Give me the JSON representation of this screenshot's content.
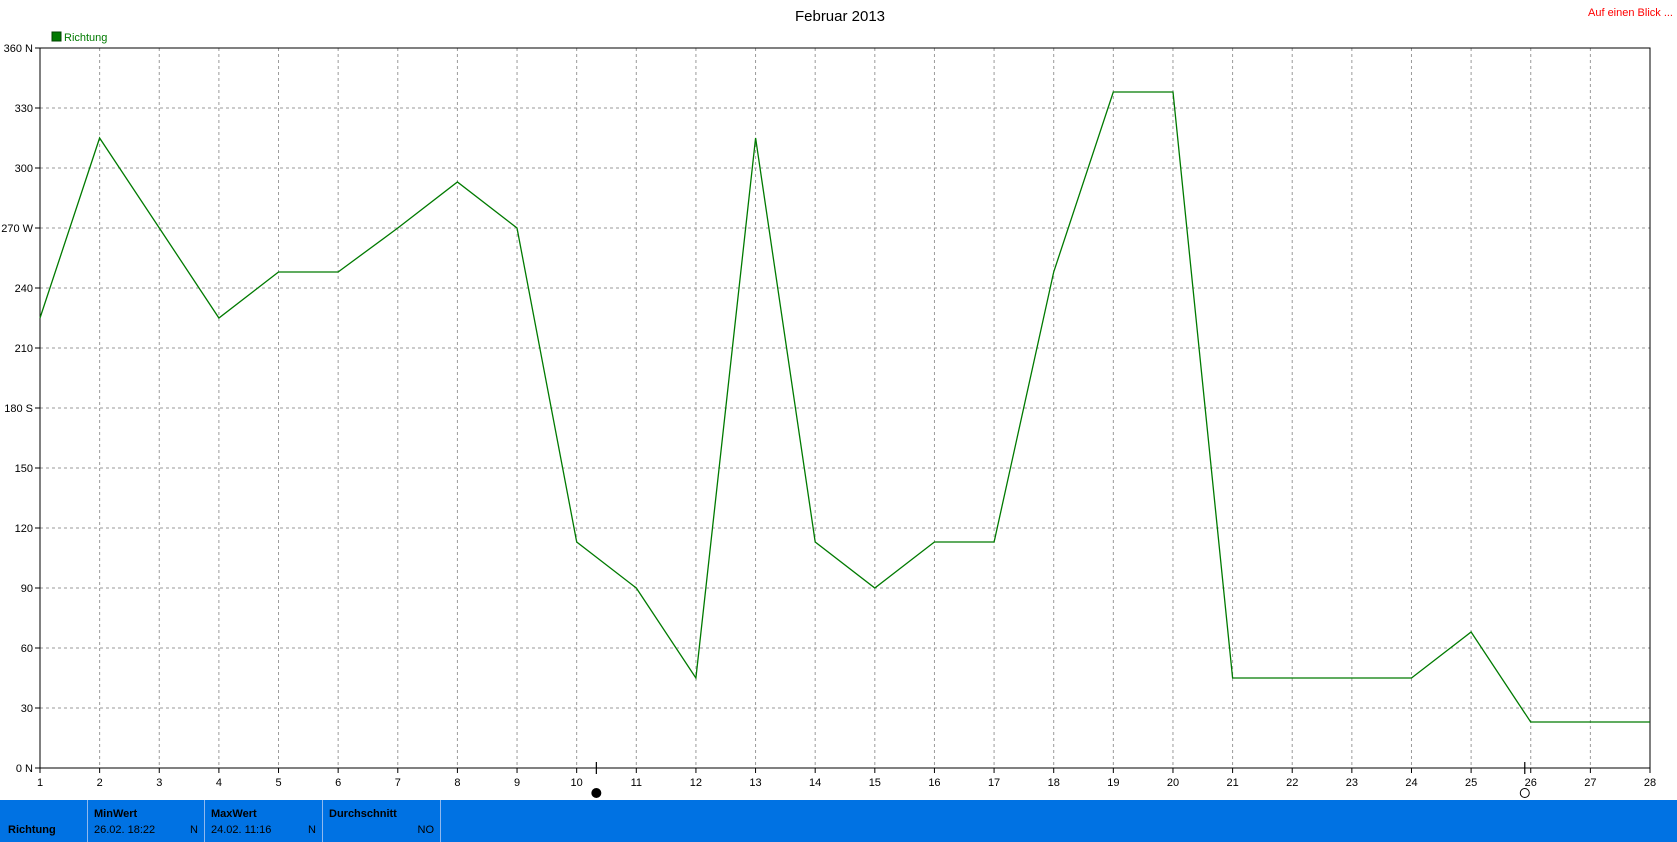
{
  "title": "Februar 2013",
  "link": "Auf einen Blick ...",
  "legend": {
    "label": "Richtung",
    "color": "#007a00"
  },
  "chart_data": {
    "type": "line",
    "title": "Februar 2013",
    "x": [
      1,
      2,
      3,
      4,
      5,
      6,
      7,
      8,
      9,
      10,
      11,
      12,
      13,
      14,
      15,
      16,
      17,
      18,
      19,
      20,
      21,
      22,
      23,
      24,
      25,
      26,
      27,
      28
    ],
    "xlim": [
      1,
      28
    ],
    "ylim": [
      0,
      360
    ],
    "y_ticks": [
      {
        "value": 360,
        "label": "360 N"
      },
      {
        "value": 330,
        "label": "330"
      },
      {
        "value": 300,
        "label": "300"
      },
      {
        "value": 270,
        "label": "270 W"
      },
      {
        "value": 240,
        "label": "240"
      },
      {
        "value": 210,
        "label": "210"
      },
      {
        "value": 180,
        "label": "180 S"
      },
      {
        "value": 150,
        "label": "150"
      },
      {
        "value": 120,
        "label": "120"
      },
      {
        "value": 90,
        "label": "90"
      },
      {
        "value": 60,
        "label": "60"
      },
      {
        "value": 30,
        "label": "30"
      },
      {
        "value": 0,
        "label": "0 N"
      }
    ],
    "grid": true,
    "legend_position": "top-left",
    "series": [
      {
        "name": "Richtung",
        "color": "#007a00",
        "values": [
          225,
          315,
          270,
          225,
          248,
          248,
          270,
          293,
          270,
          113,
          90,
          45,
          315,
          113,
          90,
          113,
          113,
          248,
          338,
          338,
          45,
          45,
          45,
          45,
          68,
          23,
          23,
          23
        ]
      }
    ],
    "markers": [
      {
        "x": 10.33,
        "symbol": "new-moon"
      },
      {
        "x": 25.9,
        "symbol": "full-moon"
      }
    ]
  },
  "footer": {
    "row_label": "Richtung",
    "min": {
      "header": "MinWert",
      "value": "26.02.  18:22",
      "dir": "N"
    },
    "max": {
      "header": "MaxWert",
      "value": "24.02.  11:16",
      "dir": "N"
    },
    "avg": {
      "header": "Durchschnitt",
      "dir": "NO"
    }
  }
}
